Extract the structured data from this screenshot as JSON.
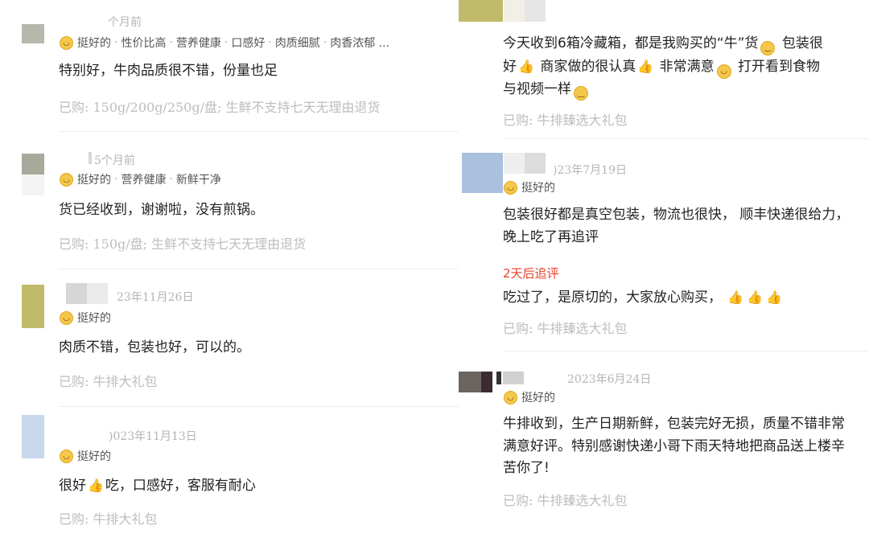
{
  "left_reviews": [
    {
      "date": "个月前",
      "rating": "挺好的",
      "tags": [
        "性价比高",
        "营养健康",
        "口感好",
        "肉质细腻",
        "肉香浓郁 ..."
      ],
      "text": "特别好，牛肉品质很不错，份量也足",
      "meta": "已购: 150g/200g/250g/盘; 生鲜不支持七天无理由退货",
      "avatar_color": "#b6b8ac"
    },
    {
      "date": "5个月前",
      "rating": "挺好的",
      "tags": [
        "营养健康",
        "新鲜干净"
      ],
      "text": "货已经收到，谢谢啦，没有煎锅。",
      "meta": "已购: 150g/盘; 生鲜不支持七天无理由退货",
      "avatar_color": "#a7a99a"
    },
    {
      "date": "23年11月26日",
      "rating": "挺好的",
      "tags": [],
      "text": "肉质不错，包装也好，可以的。",
      "meta": "已购: 牛排大礼包",
      "avatar_color": "#c0bb6a"
    },
    {
      "date": ")023年11月13日",
      "rating": "挺好的",
      "tags": [],
      "text_parts": [
        "很好",
        "吃，口感好，客服有耐心"
      ],
      "meta": "已购: 牛排大礼包",
      "avatar_color": "#c9d7ea"
    }
  ],
  "right_reviews": [
    {
      "text_lines": [
        [
          "今天收到6箱冷藏箱，都是我购买的“牛”货",
          "grin",
          " 包装很"
        ],
        [
          "好",
          "thumb",
          " 商家做的很认真",
          "thumb",
          " 非常满意",
          "smile",
          " 打开看到食物"
        ],
        [
          "与视频一样",
          "grin"
        ]
      ],
      "meta": "已购: 牛排臻选大礼包"
    },
    {
      "date": ")23年7月19日",
      "rating": "挺好的",
      "text": "包装很好都是真空包装，物流也很快， 顺丰快递很给力，晚上吃了再追评",
      "followup_label": "2天后追评",
      "followup_text": "吃过了，是原切的，大家放心购买，",
      "meta": "已购: 牛排臻选大礼包",
      "avatar_color": "#a9c0de"
    },
    {
      "date": "2023年6月24日",
      "rating": "挺好的",
      "text": "牛排收到，生产日期新鲜，包装完好无损，质量不错非常满意好评。特别感谢快递小哥下雨天特地把商品送上楼辛苦你了!",
      "meta": "已购: 牛排臻选大礼包",
      "avatar_color": "#6b6561"
    }
  ]
}
